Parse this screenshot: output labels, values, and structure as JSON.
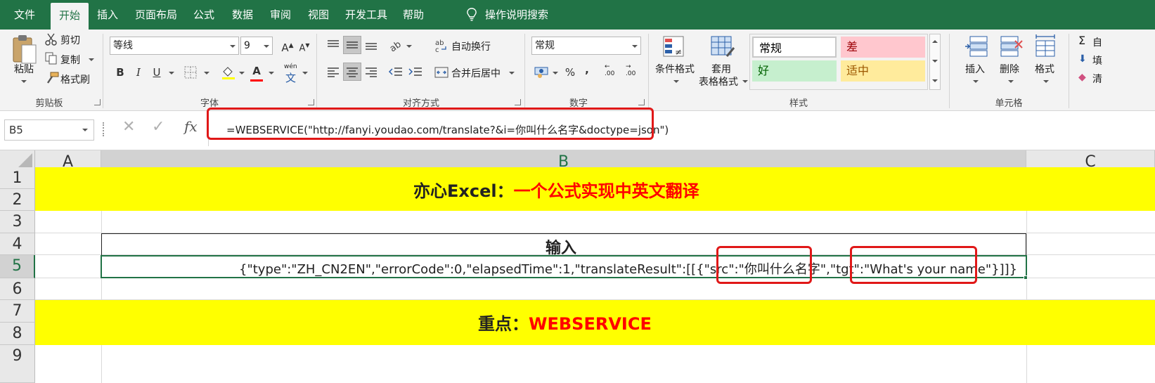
{
  "tabs": [
    "文件",
    "开始",
    "插入",
    "页面布局",
    "公式",
    "数据",
    "审阅",
    "视图",
    "开发工具",
    "帮助"
  ],
  "active_tab": "开始",
  "search_label": "操作说明搜索",
  "ribbon": {
    "clipboard": {
      "paste": "粘贴",
      "cut": "剪切",
      "copy": "复制",
      "format_painter": "格式刷",
      "label": "剪贴板"
    },
    "font": {
      "font_name": "等线",
      "font_size": "9",
      "grow": "A",
      "shrink": "A",
      "bold": "B",
      "italic": "I",
      "underline": "U",
      "font_color": "A",
      "phonetic": "wén",
      "label": "字体"
    },
    "alignment": {
      "wrap_text": "自动换行",
      "merge_center": "合并后居中",
      "label": "对齐方式"
    },
    "number": {
      "format": "常规",
      "percent": "%",
      "comma": ",",
      "inc_decimal": ".00",
      "dec_decimal": ".00",
      "label": "数字"
    },
    "styles": {
      "conditional_format": "条件格式",
      "format_table_1": "套用",
      "format_table_2": "表格格式",
      "cells": [
        {
          "name": "常规",
          "bg": "#ffffff",
          "color": "#000000"
        },
        {
          "name": "差",
          "bg": "#ffc7ce",
          "color": "#9c0006"
        },
        {
          "name": "好",
          "bg": "#c6efce",
          "color": "#006100"
        },
        {
          "name": "适中",
          "bg": "#ffeb9c",
          "color": "#9c5700"
        }
      ],
      "label": "样式"
    },
    "cells_group": {
      "insert": "插入",
      "delete": "删除",
      "format": "格式",
      "label": "单元格"
    },
    "editing": {
      "autosum": "自",
      "fill": "填",
      "clear": "清"
    }
  },
  "formula_bar": {
    "name_box": "B5",
    "fx": "fx",
    "formula": "=WEBSERVICE(\"http://fanyi.youdao.com/translate?&i=你叫什么名字&doctype=json\")"
  },
  "grid": {
    "columns": [
      "A",
      "B",
      "C"
    ],
    "rows": [
      "1",
      "2",
      "3",
      "4",
      "5",
      "6",
      "7",
      "8",
      "9"
    ],
    "title_prefix": "亦心Excel：",
    "title_main": "一个公式实现中英文翻译",
    "input_header": "输入",
    "b5_part1": "{\"type\":\"ZH_CN2EN\",\"errorCode\":0,\"elapsedTime\":1,\"translateResult\":[[{\"src\":\"",
    "b5_src": "你叫什么名字",
    "b5_part2": "\",\"tgt\":\"",
    "b5_tgt": "What's your name",
    "b5_part3": "\"}]]}",
    "key_prefix": "重点：",
    "key_main": "WEBSERVICE"
  },
  "colors": {
    "excel_green": "#217346",
    "highlight_yellow": "#ffff00",
    "title_red": "#ff0000",
    "annotation_red": "#e01818"
  }
}
